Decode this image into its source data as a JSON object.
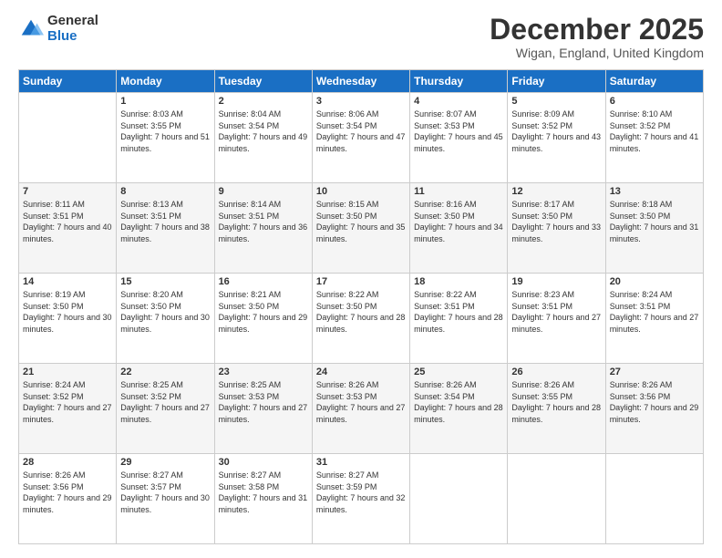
{
  "logo": {
    "general": "General",
    "blue": "Blue"
  },
  "title": "December 2025",
  "location": "Wigan, England, United Kingdom",
  "days_of_week": [
    "Sunday",
    "Monday",
    "Tuesday",
    "Wednesday",
    "Thursday",
    "Friday",
    "Saturday"
  ],
  "weeks": [
    [
      {
        "num": "",
        "sunrise": "",
        "sunset": "",
        "daylight": ""
      },
      {
        "num": "1",
        "sunrise": "Sunrise: 8:03 AM",
        "sunset": "Sunset: 3:55 PM",
        "daylight": "Daylight: 7 hours and 51 minutes."
      },
      {
        "num": "2",
        "sunrise": "Sunrise: 8:04 AM",
        "sunset": "Sunset: 3:54 PM",
        "daylight": "Daylight: 7 hours and 49 minutes."
      },
      {
        "num": "3",
        "sunrise": "Sunrise: 8:06 AM",
        "sunset": "Sunset: 3:54 PM",
        "daylight": "Daylight: 7 hours and 47 minutes."
      },
      {
        "num": "4",
        "sunrise": "Sunrise: 8:07 AM",
        "sunset": "Sunset: 3:53 PM",
        "daylight": "Daylight: 7 hours and 45 minutes."
      },
      {
        "num": "5",
        "sunrise": "Sunrise: 8:09 AM",
        "sunset": "Sunset: 3:52 PM",
        "daylight": "Daylight: 7 hours and 43 minutes."
      },
      {
        "num": "6",
        "sunrise": "Sunrise: 8:10 AM",
        "sunset": "Sunset: 3:52 PM",
        "daylight": "Daylight: 7 hours and 41 minutes."
      }
    ],
    [
      {
        "num": "7",
        "sunrise": "Sunrise: 8:11 AM",
        "sunset": "Sunset: 3:51 PM",
        "daylight": "Daylight: 7 hours and 40 minutes."
      },
      {
        "num": "8",
        "sunrise": "Sunrise: 8:13 AM",
        "sunset": "Sunset: 3:51 PM",
        "daylight": "Daylight: 7 hours and 38 minutes."
      },
      {
        "num": "9",
        "sunrise": "Sunrise: 8:14 AM",
        "sunset": "Sunset: 3:51 PM",
        "daylight": "Daylight: 7 hours and 36 minutes."
      },
      {
        "num": "10",
        "sunrise": "Sunrise: 8:15 AM",
        "sunset": "Sunset: 3:50 PM",
        "daylight": "Daylight: 7 hours and 35 minutes."
      },
      {
        "num": "11",
        "sunrise": "Sunrise: 8:16 AM",
        "sunset": "Sunset: 3:50 PM",
        "daylight": "Daylight: 7 hours and 34 minutes."
      },
      {
        "num": "12",
        "sunrise": "Sunrise: 8:17 AM",
        "sunset": "Sunset: 3:50 PM",
        "daylight": "Daylight: 7 hours and 33 minutes."
      },
      {
        "num": "13",
        "sunrise": "Sunrise: 8:18 AM",
        "sunset": "Sunset: 3:50 PM",
        "daylight": "Daylight: 7 hours and 31 minutes."
      }
    ],
    [
      {
        "num": "14",
        "sunrise": "Sunrise: 8:19 AM",
        "sunset": "Sunset: 3:50 PM",
        "daylight": "Daylight: 7 hours and 30 minutes."
      },
      {
        "num": "15",
        "sunrise": "Sunrise: 8:20 AM",
        "sunset": "Sunset: 3:50 PM",
        "daylight": "Daylight: 7 hours and 30 minutes."
      },
      {
        "num": "16",
        "sunrise": "Sunrise: 8:21 AM",
        "sunset": "Sunset: 3:50 PM",
        "daylight": "Daylight: 7 hours and 29 minutes."
      },
      {
        "num": "17",
        "sunrise": "Sunrise: 8:22 AM",
        "sunset": "Sunset: 3:50 PM",
        "daylight": "Daylight: 7 hours and 28 minutes."
      },
      {
        "num": "18",
        "sunrise": "Sunrise: 8:22 AM",
        "sunset": "Sunset: 3:51 PM",
        "daylight": "Daylight: 7 hours and 28 minutes."
      },
      {
        "num": "19",
        "sunrise": "Sunrise: 8:23 AM",
        "sunset": "Sunset: 3:51 PM",
        "daylight": "Daylight: 7 hours and 27 minutes."
      },
      {
        "num": "20",
        "sunrise": "Sunrise: 8:24 AM",
        "sunset": "Sunset: 3:51 PM",
        "daylight": "Daylight: 7 hours and 27 minutes."
      }
    ],
    [
      {
        "num": "21",
        "sunrise": "Sunrise: 8:24 AM",
        "sunset": "Sunset: 3:52 PM",
        "daylight": "Daylight: 7 hours and 27 minutes."
      },
      {
        "num": "22",
        "sunrise": "Sunrise: 8:25 AM",
        "sunset": "Sunset: 3:52 PM",
        "daylight": "Daylight: 7 hours and 27 minutes."
      },
      {
        "num": "23",
        "sunrise": "Sunrise: 8:25 AM",
        "sunset": "Sunset: 3:53 PM",
        "daylight": "Daylight: 7 hours and 27 minutes."
      },
      {
        "num": "24",
        "sunrise": "Sunrise: 8:26 AM",
        "sunset": "Sunset: 3:53 PM",
        "daylight": "Daylight: 7 hours and 27 minutes."
      },
      {
        "num": "25",
        "sunrise": "Sunrise: 8:26 AM",
        "sunset": "Sunset: 3:54 PM",
        "daylight": "Daylight: 7 hours and 28 minutes."
      },
      {
        "num": "26",
        "sunrise": "Sunrise: 8:26 AM",
        "sunset": "Sunset: 3:55 PM",
        "daylight": "Daylight: 7 hours and 28 minutes."
      },
      {
        "num": "27",
        "sunrise": "Sunrise: 8:26 AM",
        "sunset": "Sunset: 3:56 PM",
        "daylight": "Daylight: 7 hours and 29 minutes."
      }
    ],
    [
      {
        "num": "28",
        "sunrise": "Sunrise: 8:26 AM",
        "sunset": "Sunset: 3:56 PM",
        "daylight": "Daylight: 7 hours and 29 minutes."
      },
      {
        "num": "29",
        "sunrise": "Sunrise: 8:27 AM",
        "sunset": "Sunset: 3:57 PM",
        "daylight": "Daylight: 7 hours and 30 minutes."
      },
      {
        "num": "30",
        "sunrise": "Sunrise: 8:27 AM",
        "sunset": "Sunset: 3:58 PM",
        "daylight": "Daylight: 7 hours and 31 minutes."
      },
      {
        "num": "31",
        "sunrise": "Sunrise: 8:27 AM",
        "sunset": "Sunset: 3:59 PM",
        "daylight": "Daylight: 7 hours and 32 minutes."
      },
      {
        "num": "",
        "sunrise": "",
        "sunset": "",
        "daylight": ""
      },
      {
        "num": "",
        "sunrise": "",
        "sunset": "",
        "daylight": ""
      },
      {
        "num": "",
        "sunrise": "",
        "sunset": "",
        "daylight": ""
      }
    ]
  ]
}
